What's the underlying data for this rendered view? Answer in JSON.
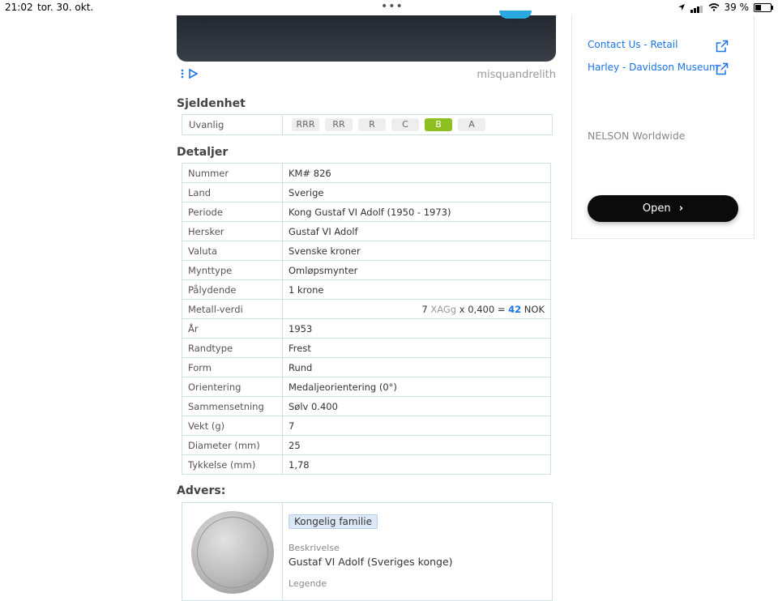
{
  "status_bar": {
    "time": "21:02",
    "date": "tor. 30. okt.",
    "battery_percent": "39 %",
    "battery_level": 0.39
  },
  "ad": {
    "brand": "misquandrelith",
    "accent_color": "#2aa9e0"
  },
  "rarity": {
    "heading": "Sjeldenhet",
    "label": "Uvanlig",
    "levels": [
      "RRR",
      "RR",
      "R",
      "C",
      "B",
      "A"
    ],
    "selected": "B",
    "selected_color": "#8cbf1f"
  },
  "details": {
    "heading": "Detaljer",
    "rows": [
      {
        "key": "Nummer",
        "value": "KM# 826"
      },
      {
        "key": "Land",
        "value": "Sverige"
      },
      {
        "key": "Periode",
        "value": "Kong Gustaf VI Adolf (1950 - 1973)"
      },
      {
        "key": "Hersker",
        "value": "Gustaf VI Adolf"
      },
      {
        "key": "Valuta",
        "value": "Svenske kroner"
      },
      {
        "key": "Mynttype",
        "value": "Omløpsmynter"
      },
      {
        "key": "Pålydende",
        "value": "1 krone"
      },
      {
        "key": "Metall-verdi",
        "value": ""
      },
      {
        "key": "År",
        "value": "1953"
      },
      {
        "key": "Randtype",
        "value": "Frest"
      },
      {
        "key": "Form",
        "value": "Rund"
      },
      {
        "key": "Orientering",
        "value": "Medaljeorientering (0°)"
      },
      {
        "key": "Sammensetning",
        "value": "Sølv 0.400"
      },
      {
        "key": "Vekt (g)",
        "value": "7"
      },
      {
        "key": "Diameter (mm)",
        "value": "25"
      },
      {
        "key": "Tykkelse (mm)",
        "value": "1,78"
      }
    ],
    "metal_value": {
      "weight": "7",
      "unit": "XAGg",
      "times": "x",
      "fineness": "0,400",
      "equals": "=",
      "amount": "42",
      "currency": "NOK"
    }
  },
  "obverse": {
    "heading": "Advers:",
    "tag": "Kongelig familie",
    "description_label": "Beskrivelse",
    "description": "Gustaf VI Adolf (Sveriges konge)",
    "legend_label": "Legende"
  },
  "sidebar": {
    "links": [
      "Contact Us - Retail",
      "Harley - Davidson Museum"
    ],
    "brand": "NELSON Worldwide",
    "open_label": "Open"
  }
}
